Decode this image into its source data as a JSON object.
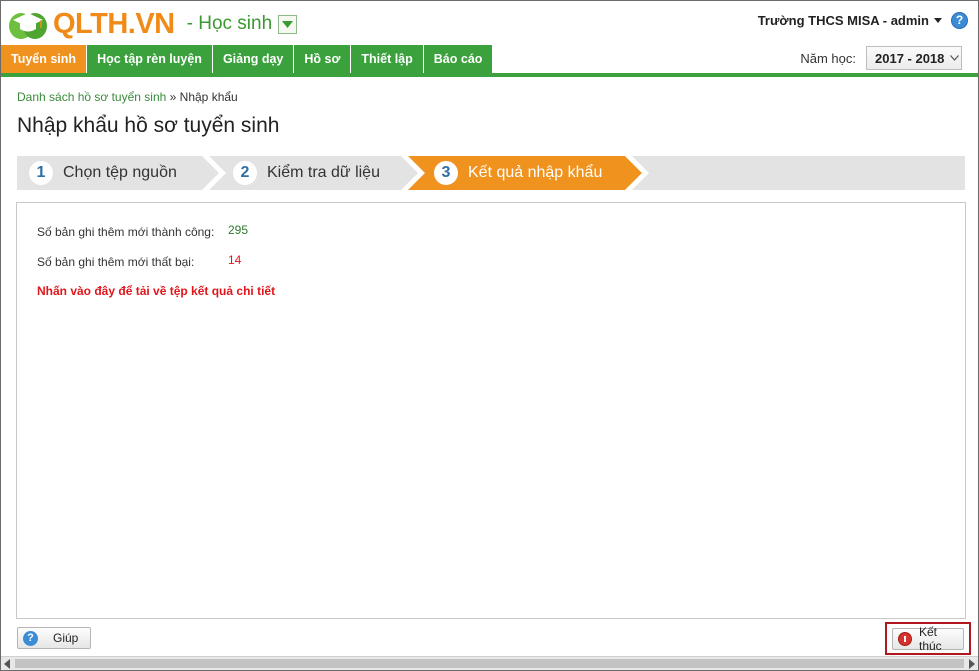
{
  "header": {
    "logo_text": "QLTH.VN",
    "module": "- Học sinh",
    "user": "Trường THCS MISA - admin",
    "help_icon": "help-icon"
  },
  "nav": {
    "tabs": [
      {
        "label": "Tuyển sinh",
        "active": true
      },
      {
        "label": "Học tập rèn luyện",
        "active": false
      },
      {
        "label": "Giảng dạy",
        "active": false
      },
      {
        "label": "Hồ sơ",
        "active": false
      },
      {
        "label": "Thiết lập",
        "active": false
      },
      {
        "label": "Báo cáo",
        "active": false
      }
    ],
    "year_label": "Năm học:",
    "year_value": "2017 - 2018"
  },
  "breadcrumb": {
    "parent": "Danh sách hồ sơ tuyển sinh",
    "separator": "»",
    "current": "Nhập khẩu"
  },
  "page_title": "Nhập khẩu hồ sơ tuyển sinh",
  "steps": [
    {
      "num": "1",
      "label": "Chọn tệp nguồn",
      "active": false
    },
    {
      "num": "2",
      "label": "Kiểm tra dữ liệu",
      "active": false
    },
    {
      "num": "3",
      "label": "Kết quả nhập khẩu",
      "active": true
    }
  ],
  "result": {
    "success_label": "Số bản ghi thêm mới thành công:",
    "success_value": "295",
    "fail_label": "Số bản ghi thêm mới thất bại:",
    "fail_value": "14",
    "download_link": "Nhấn vào đây để tải về tệp kết quả chi tiết"
  },
  "footer": {
    "help_label": "Giúp",
    "finish_label": "Kết thúc"
  },
  "colors": {
    "brand_orange": "#f0921e",
    "brand_green": "#3aa13d",
    "error_red": "#e0161b",
    "success_green": "#2d7a2d",
    "highlight_border": "#b0171f"
  }
}
